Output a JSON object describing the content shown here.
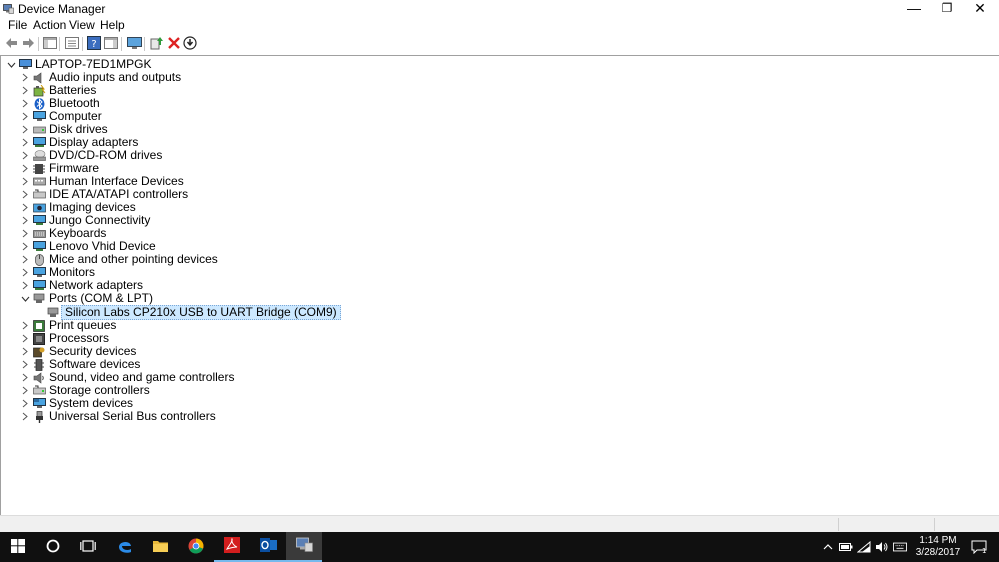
{
  "window": {
    "title": "Device Manager",
    "controls": {
      "minimize": "—",
      "maximize": "❐",
      "close": "✕"
    }
  },
  "menu": [
    "File",
    "Action",
    "View",
    "Help"
  ],
  "toolbar": {
    "icons": [
      "back-icon",
      "forward-icon",
      "show-hide-console-tree-icon",
      "properties-icon",
      "help-icon",
      "show-hide-action-pane-icon",
      "monitor-icon",
      "update-driver-icon",
      "uninstall-icon",
      "download-icon"
    ]
  },
  "tree": {
    "root": "LAPTOP-7ED1MPGK",
    "categories": [
      {
        "label": "Audio inputs and outputs",
        "icon": "speaker-icon",
        "expanded": false
      },
      {
        "label": "Batteries",
        "icon": "battery-icon",
        "expanded": false
      },
      {
        "label": "Bluetooth",
        "icon": "bluetooth-icon",
        "expanded": false
      },
      {
        "label": "Computer",
        "icon": "computer-icon",
        "expanded": false
      },
      {
        "label": "Disk drives",
        "icon": "disk-drive-icon",
        "expanded": false
      },
      {
        "label": "Display adapters",
        "icon": "display-adapter-icon",
        "expanded": false
      },
      {
        "label": "DVD/CD-ROM drives",
        "icon": "dvd-icon",
        "expanded": false
      },
      {
        "label": "Firmware",
        "icon": "firmware-icon",
        "expanded": false
      },
      {
        "label": "Human Interface Devices",
        "icon": "hid-icon",
        "expanded": false
      },
      {
        "label": "IDE ATA/ATAPI controllers",
        "icon": "ide-controller-icon",
        "expanded": false
      },
      {
        "label": "Imaging devices",
        "icon": "camera-icon",
        "expanded": false
      },
      {
        "label": "Jungo Connectivity",
        "icon": "jungo-icon",
        "expanded": false
      },
      {
        "label": "Keyboards",
        "icon": "keyboard-icon",
        "expanded": false
      },
      {
        "label": "Lenovo Vhid Device",
        "icon": "lenovo-vhid-icon",
        "expanded": false
      },
      {
        "label": "Mice and other pointing devices",
        "icon": "mouse-icon",
        "expanded": false
      },
      {
        "label": "Monitors",
        "icon": "monitor-icon",
        "expanded": false
      },
      {
        "label": "Network adapters",
        "icon": "network-adapter-icon",
        "expanded": false
      },
      {
        "label": "Ports (COM & LPT)",
        "icon": "port-icon",
        "expanded": true
      },
      {
        "label": "Print queues",
        "icon": "printer-icon",
        "expanded": false
      },
      {
        "label": "Processors",
        "icon": "processor-icon",
        "expanded": false
      },
      {
        "label": "Security devices",
        "icon": "security-device-icon",
        "expanded": false
      },
      {
        "label": "Software devices",
        "icon": "software-device-icon",
        "expanded": false
      },
      {
        "label": "Sound, video and game controllers",
        "icon": "sound-controller-icon",
        "expanded": false
      },
      {
        "label": "Storage controllers",
        "icon": "storage-controller-icon",
        "expanded": false
      },
      {
        "label": "System devices",
        "icon": "system-device-icon",
        "expanded": false
      },
      {
        "label": "Universal Serial Bus controllers",
        "icon": "usb-icon",
        "expanded": false
      }
    ],
    "ports_children": [
      {
        "label": "Silicon Labs CP210x USB to UART Bridge (COM9)",
        "icon": "port-icon",
        "selected": true
      }
    ]
  },
  "taskbar": {
    "apps": [
      {
        "name": "start-button",
        "icon": "windows-logo-icon"
      },
      {
        "name": "cortana-button",
        "icon": "cortana-circle-icon"
      },
      {
        "name": "task-view-button",
        "icon": "task-view-icon"
      },
      {
        "name": "edge-button",
        "icon": "edge-icon"
      },
      {
        "name": "file-explorer-button",
        "icon": "folder-icon"
      },
      {
        "name": "chrome-button",
        "icon": "chrome-icon"
      },
      {
        "name": "acrobat-button",
        "icon": "acrobat-icon"
      },
      {
        "name": "outlook-button",
        "icon": "outlook-icon"
      },
      {
        "name": "device-manager-button",
        "icon": "device-manager-icon"
      }
    ],
    "tray_icons": [
      "chevron-up-icon",
      "battery-tray-icon",
      "wifi-icon",
      "volume-icon",
      "keyboard-tray-icon"
    ],
    "time": "1:14 PM",
    "date": "3/28/2017",
    "notification_count": "1"
  },
  "colors": {
    "selection": "#cce8ff",
    "taskbar": "#101010",
    "accent": "#76b9ed"
  }
}
